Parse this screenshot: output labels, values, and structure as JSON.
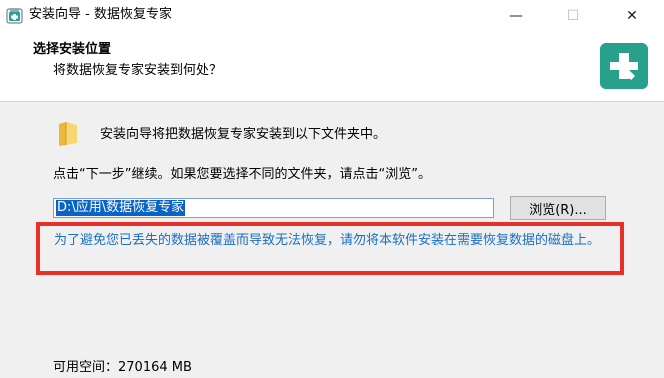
{
  "window": {
    "title": "安装向导 - 数据恢复专家",
    "minimize_glyph": "—",
    "maximize_glyph": "☐",
    "close_glyph": "✕"
  },
  "header": {
    "title": "选择安装位置",
    "subtitle": "将数据恢复专家安装到何处？",
    "logo_icon": "medical-cross-icon",
    "logo_color": "#27a08c"
  },
  "content": {
    "intro": "安装向导将把数据恢复专家安装到以下文件夹中。",
    "instruction": "点击“下一步”继续。如果您要选择不同的文件夹，请点击“浏览”。",
    "path_value": "D:\\应用\\数据恢复专家",
    "browse_label": "浏览(R)...",
    "warning": "为了避免您已丢失的数据被覆盖而导致无法恢复，请勿将本软件安装在需要恢复数据的磁盘上。",
    "warning_border_color": "#e8302a",
    "warning_text_color": "#1a6fc4",
    "free_space": "可用空间：270164 MB"
  }
}
